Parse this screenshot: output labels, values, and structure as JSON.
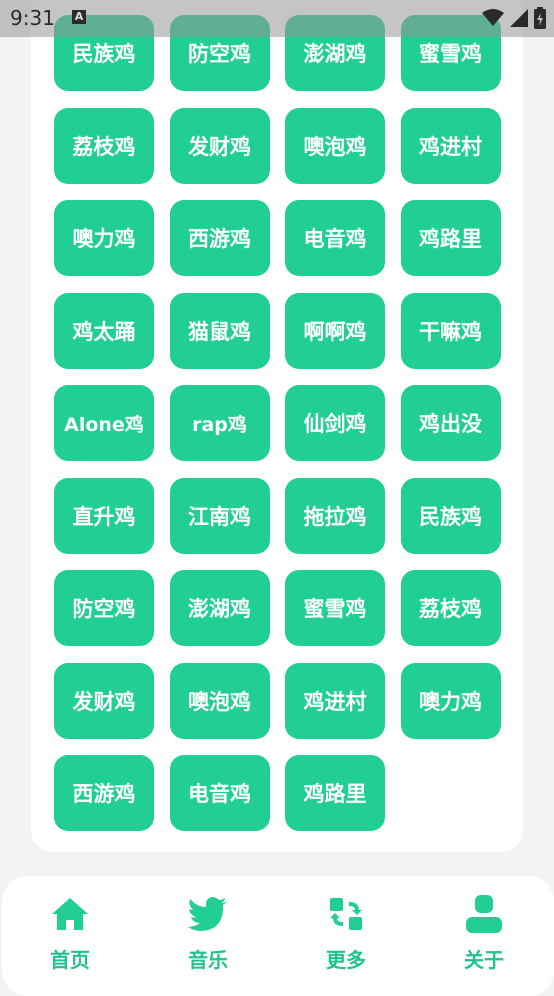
{
  "status": {
    "time": "9:31",
    "notif": "A"
  },
  "chips": [
    {
      "label": "民族鸡"
    },
    {
      "label": "防空鸡"
    },
    {
      "label": "澎湖鸡"
    },
    {
      "label": "蜜雪鸡"
    },
    {
      "label": "荔枝鸡"
    },
    {
      "label": "发财鸡"
    },
    {
      "label": "噢泡鸡"
    },
    {
      "label": "鸡进村"
    },
    {
      "label": "噢力鸡"
    },
    {
      "label": "西游鸡"
    },
    {
      "label": "电音鸡"
    },
    {
      "label": "鸡路里"
    },
    {
      "label": "鸡太踊"
    },
    {
      "label": "猫鼠鸡"
    },
    {
      "label": "啊啊鸡"
    },
    {
      "label": "干嘛鸡"
    },
    {
      "label": "Alone鸡"
    },
    {
      "label": "rap鸡"
    },
    {
      "label": "仙剑鸡"
    },
    {
      "label": "鸡出没"
    },
    {
      "label": "直升鸡"
    },
    {
      "label": "江南鸡"
    },
    {
      "label": "拖拉鸡"
    },
    {
      "label": "民族鸡"
    },
    {
      "label": "防空鸡"
    },
    {
      "label": "澎湖鸡"
    },
    {
      "label": "蜜雪鸡"
    },
    {
      "label": "荔枝鸡"
    },
    {
      "label": "发财鸡"
    },
    {
      "label": "噢泡鸡"
    },
    {
      "label": "鸡进村"
    },
    {
      "label": "噢力鸡"
    },
    {
      "label": "西游鸡"
    },
    {
      "label": "电音鸡"
    },
    {
      "label": "鸡路里"
    }
  ],
  "nav": {
    "home": {
      "label": "首页",
      "icon": "home-icon"
    },
    "music": {
      "label": "音乐",
      "icon": "twitter-bird-icon"
    },
    "more": {
      "label": "更多",
      "icon": "refresh-apps-icon"
    },
    "about": {
      "label": "关于",
      "icon": "user-icon"
    }
  },
  "colors": {
    "accent": "#21cf95",
    "nav_text": "#21c28e"
  }
}
